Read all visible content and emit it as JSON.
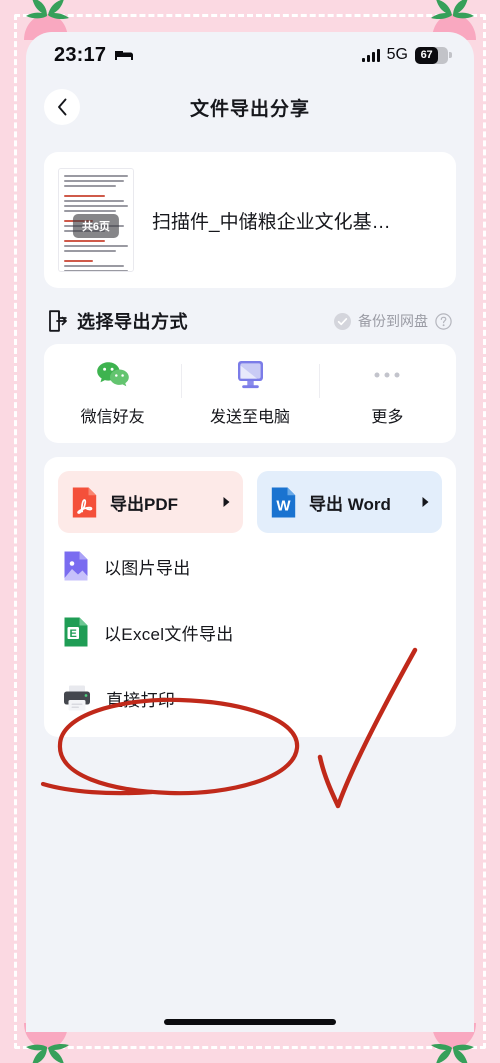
{
  "theme": {
    "frame_pink": "#fbd9e2",
    "screen_bg": "#f1f3f8",
    "card_bg": "#ffffff",
    "pdf_bg": "#fdeae8",
    "pdf_accent": "#f4503a",
    "word_bg": "#e3eefb",
    "word_accent": "#1a73d0",
    "wechat_green": "#3eb34f",
    "excel_green": "#1f9d55",
    "image_purple": "#7a6cf0",
    "annotation_red": "#c0291a",
    "text_primary": "#16171c",
    "text_muted": "#9b9ca5"
  },
  "status_bar": {
    "time": "23:17",
    "bed_icon": "bed-icon",
    "signal_icon": "signal-bars-icon",
    "network": "5G",
    "battery_level": "67",
    "battery_icon": "battery-icon"
  },
  "nav": {
    "back_icon": "chevron-left-icon",
    "title": "文件导出分享"
  },
  "document": {
    "thumbnail_name": "document-thumbnail",
    "page_badge": "共6页",
    "title": "扫描件_中储粮企业文化基…"
  },
  "section": {
    "icon": "export-file-icon",
    "title": "选择导出方式",
    "backup_check_icon": "check-circle-icon",
    "backup_label": "备份到网盘",
    "help_icon": "question-circle-icon"
  },
  "share_options": [
    {
      "icon": "wechat-icon",
      "label": "微信好友"
    },
    {
      "icon": "monitor-icon",
      "label": "发送至电脑"
    },
    {
      "icon": "more-dots-icon",
      "label": "更多"
    }
  ],
  "export_buttons": [
    {
      "icon": "pdf-file-icon",
      "label": "导出PDF",
      "arrow": "caret-right-icon"
    },
    {
      "icon": "word-file-icon",
      "label": "导出 Word",
      "arrow": "caret-right-icon"
    }
  ],
  "export_list": [
    {
      "icon": "image-file-icon",
      "label": "以图片导出"
    },
    {
      "icon": "excel-file-icon",
      "label": "以Excel文件导出"
    },
    {
      "icon": "printer-icon",
      "label": "直接打印"
    }
  ],
  "annotations": {
    "circle": "red-ellipse-around-print-option",
    "check": "red-checkmark"
  }
}
